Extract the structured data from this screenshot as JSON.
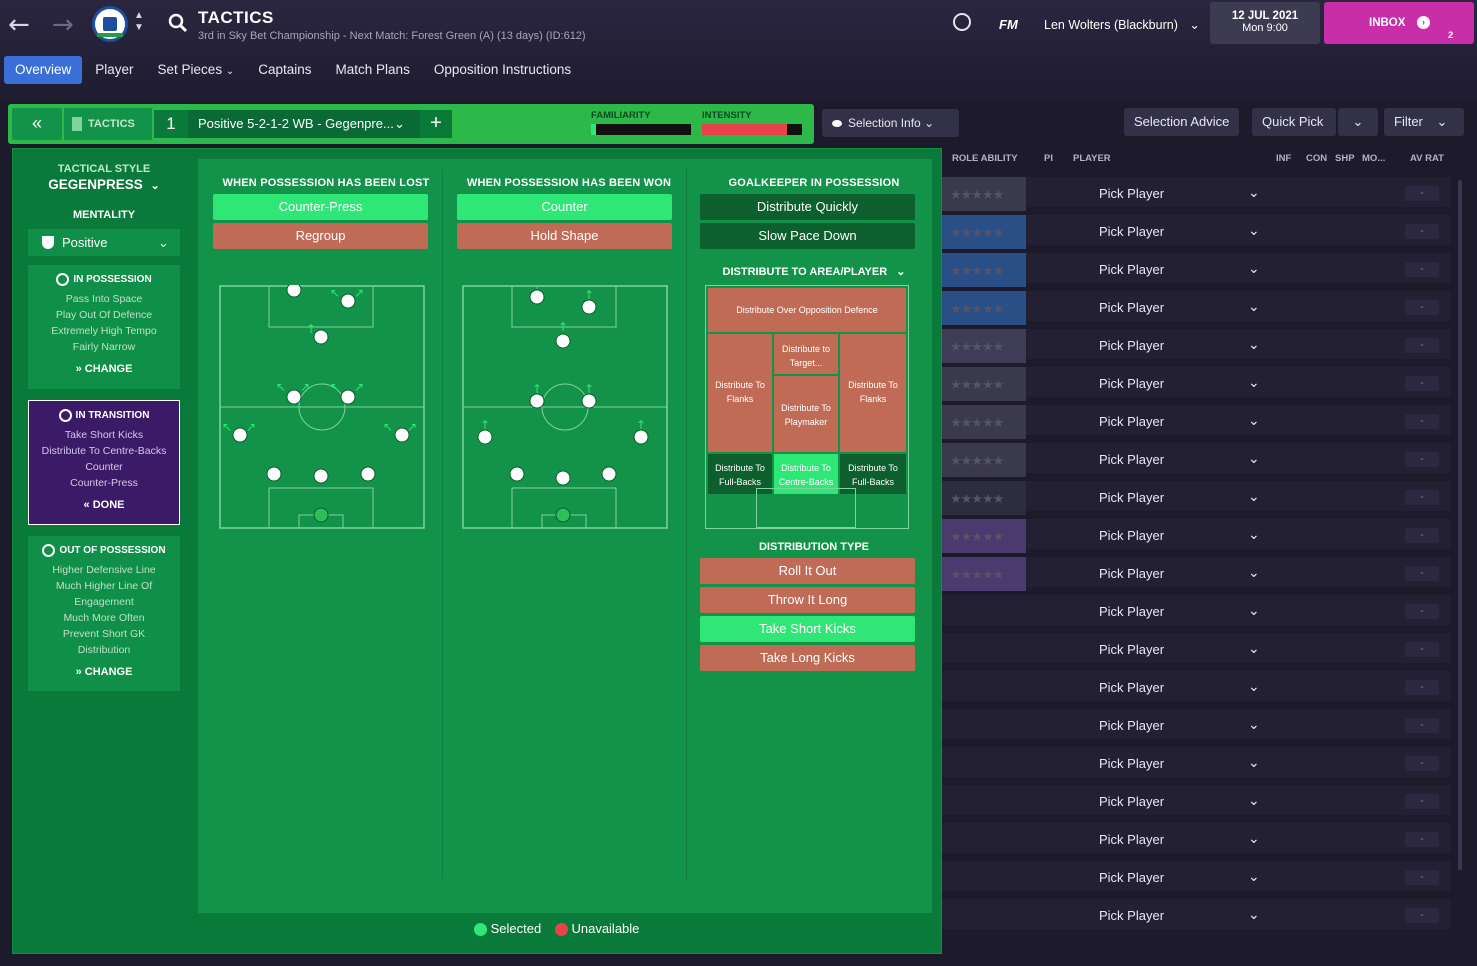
{
  "header": {
    "title": "TACTICS",
    "subtitle": "3rd in Sky Bet Championship - Next Match: Forest Green (A) (13 days) (ID:612)",
    "manager": "Len Wolters (Blackburn)",
    "fm": "FM",
    "date": "12 JUL 2021",
    "time": "Mon 9:00",
    "inbox_label": "INBOX",
    "inbox_count": "2"
  },
  "nav": {
    "tabs": [
      "Overview",
      "Player",
      "Set Pieces",
      "Captains",
      "Match Plans",
      "Opposition Instructions"
    ]
  },
  "tacbar": {
    "tactics_label": "TACTICS",
    "slot": "1",
    "tactic_name": "Positive 5-2-1-2 WB - Gegenpre...",
    "familiarity_label": "FAMILIARITY",
    "intensity_label": "INTENSITY",
    "familiarity_fill": 0.05,
    "intensity_fill": 0.85
  },
  "left": {
    "style_label": "TACTICAL STYLE",
    "style_value": "GEGENPRESS",
    "mentality_label": "MENTALITY",
    "mentality_value": "Positive",
    "in_possession": {
      "title": "IN POSSESSION",
      "lines": [
        "Pass Into Space",
        "Play Out Of Defence",
        "Extremely High Tempo",
        "Fairly Narrow"
      ],
      "button": "CHANGE"
    },
    "in_transition": {
      "title": "IN TRANSITION",
      "lines": [
        "Take Short Kicks",
        "Distribute To Centre-Backs",
        "Counter",
        "Counter-Press"
      ],
      "button": "DONE"
    },
    "out_of_possession": {
      "title": "OUT OF POSSESSION",
      "lines": [
        "Higher Defensive Line",
        "Much Higher Line Of",
        "Engagement",
        "Much More Often",
        "Prevent Short GK",
        "Distribution"
      ],
      "button": "CHANGE"
    }
  },
  "lost": {
    "title": "WHEN POSSESSION HAS BEEN LOST",
    "options": [
      "Counter-Press",
      "Regroup"
    ]
  },
  "won": {
    "title": "WHEN POSSESSION HAS BEEN WON",
    "options": [
      "Counter",
      "Hold Shape"
    ]
  },
  "gk": {
    "title": "GOALKEEPER IN POSSESSION",
    "options": [
      "Distribute Quickly",
      "Slow Pace Down"
    ],
    "area_title": "DISTRIBUTE TO AREA/PLAYER",
    "zones": {
      "over": "Distribute Over Opposition Defence",
      "target": "Distribute to Target...",
      "flanks_l": "Distribute To Flanks",
      "flanks_r": "Distribute To Flanks",
      "playmaker": "Distribute To Playmaker",
      "fb_l": "Distribute To Full-Backs",
      "cb": "Distribute To Centre-Backs",
      "fb_r": "Distribute To Full-Backs"
    },
    "type_title": "DISTRIBUTION TYPE",
    "types": [
      "Roll It Out",
      "Throw It Long",
      "Take Short Kicks",
      "Take Long Kicks"
    ]
  },
  "legend": {
    "selected": "Selected",
    "unavailable": "Unavailable"
  },
  "right": {
    "selection_info": "Selection Info",
    "selection_advice": "Selection Advice",
    "quick_pick": "Quick Pick",
    "filter": "Filter",
    "columns": [
      "ROLE ABILITY",
      "PI",
      "PLAYER",
      "INF",
      "CON",
      "SHP",
      "MO...",
      "AV RAT"
    ],
    "rows": [
      "Pick Player",
      "Pick Player",
      "Pick Player",
      "Pick Player",
      "Pick Player",
      "Pick Player",
      "Pick Player",
      "Pick Player",
      "Pick Player",
      "Pick Player",
      "Pick Player",
      "Pick Player",
      "Pick Player",
      "Pick Player",
      "Pick Player",
      "Pick Player",
      "Pick Player",
      "Pick Player",
      "Pick Player",
      "Pick Player"
    ],
    "rating": "-",
    "stars": "★★★★★"
  },
  "colors": {
    "selected": "#2fe777",
    "unavailable": "#c06b56",
    "accent": "#3a6fd8",
    "inbox": "#c92ea9"
  }
}
